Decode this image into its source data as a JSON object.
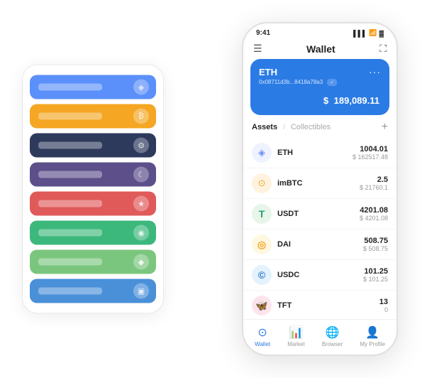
{
  "status_bar": {
    "time": "9:41",
    "signal": "▌▌▌",
    "wifi": "WiFi",
    "battery": "🔋"
  },
  "nav": {
    "menu_icon": "☰",
    "title": "Wallet",
    "expand_icon": "⛶"
  },
  "eth_card": {
    "title": "ETH",
    "dots": "···",
    "address": "0x08711d3b...8418a78a3",
    "badge": "✓",
    "dollar_sign": "$",
    "amount": "189,089.11"
  },
  "assets_section": {
    "tab_active": "Assets",
    "separator": "/",
    "tab_inactive": "Collectibles",
    "add_icon": "+"
  },
  "assets": [
    {
      "name": "ETH",
      "icon": "◈",
      "icon_class": "eth-icon-bg",
      "amount": "1004.01",
      "usd": "$ 162517.48"
    },
    {
      "name": "imBTC",
      "icon": "⊙",
      "icon_class": "imbtc-icon-bg",
      "amount": "2.5",
      "usd": "$ 21760.1"
    },
    {
      "name": "USDT",
      "icon": "₮",
      "icon_class": "usdt-icon-bg",
      "amount": "4201.08",
      "usd": "$ 4201.08"
    },
    {
      "name": "DAI",
      "icon": "◎",
      "icon_class": "dai-icon-bg",
      "amount": "508.75",
      "usd": "$ 508.75"
    },
    {
      "name": "USDC",
      "icon": "©",
      "icon_class": "usdc-icon-bg",
      "amount": "101.25",
      "usd": "$ 101.25"
    },
    {
      "name": "TFT",
      "icon": "🦋",
      "icon_class": "tft-icon-bg",
      "amount": "13",
      "usd": "0"
    }
  ],
  "bottom_nav": [
    {
      "label": "Wallet",
      "icon": "⊙",
      "active": true
    },
    {
      "label": "Market",
      "icon": "📈",
      "active": false
    },
    {
      "label": "Browser",
      "icon": "👤",
      "active": false
    },
    {
      "label": "My Profile",
      "icon": "👤",
      "active": false
    }
  ],
  "card_stack": {
    "cards": [
      {
        "color_class": "c1",
        "label": ""
      },
      {
        "color_class": "c2",
        "label": ""
      },
      {
        "color_class": "c3",
        "label": ""
      },
      {
        "color_class": "c4",
        "label": ""
      },
      {
        "color_class": "c5",
        "label": ""
      },
      {
        "color_class": "c6",
        "label": ""
      },
      {
        "color_class": "c7",
        "label": ""
      },
      {
        "color_class": "c8",
        "label": ""
      }
    ]
  }
}
